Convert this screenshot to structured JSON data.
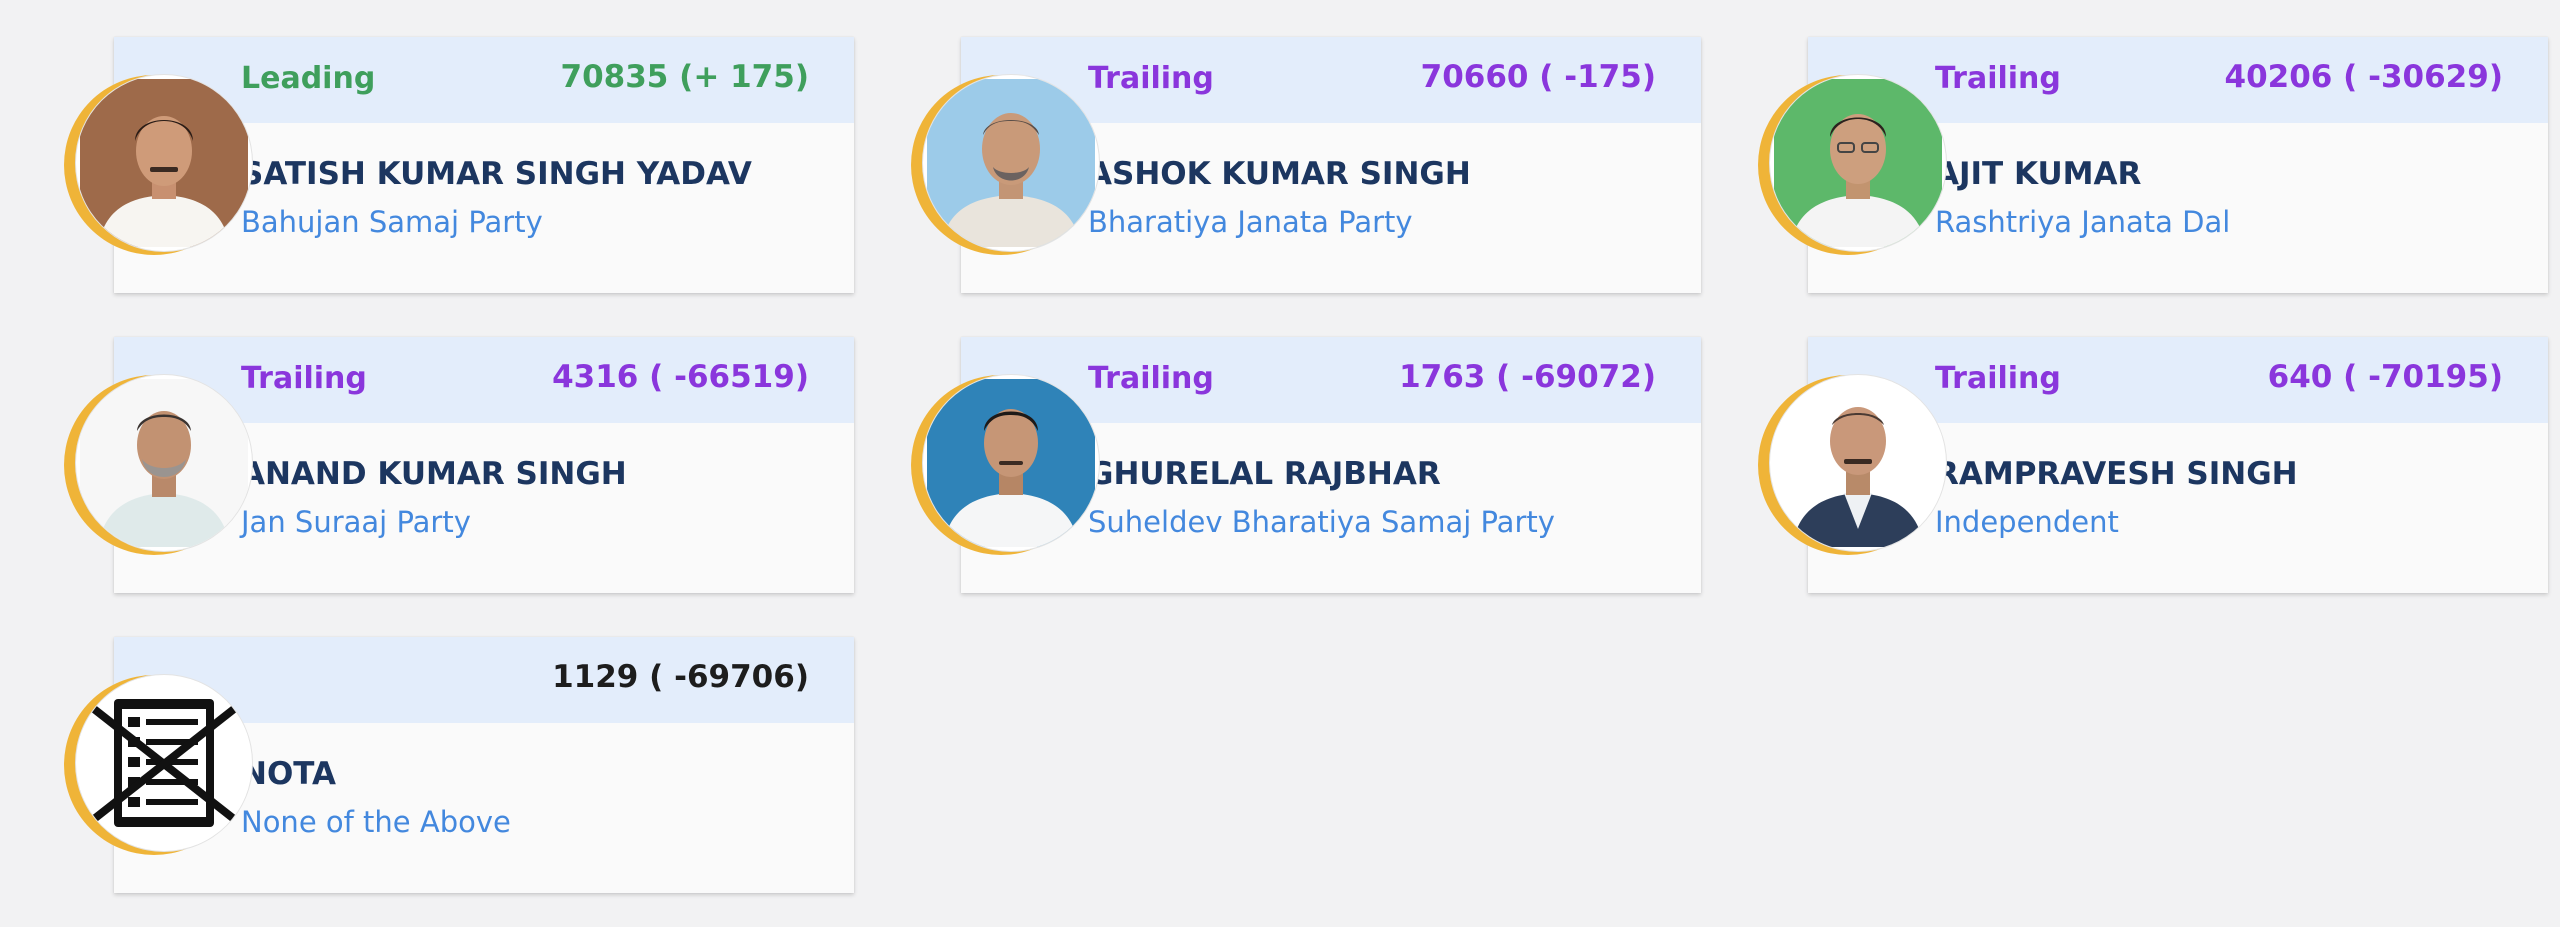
{
  "candidates": [
    {
      "status": "Leading",
      "votes": "70835 (+ 175)",
      "name": "SATISH KUMAR SINGH YADAV",
      "party": "Bahujan Samaj Party",
      "status_color": "#3f9f5c",
      "photo_icon": "candidate-photo-icon"
    },
    {
      "status": "Trailing",
      "votes": "70660 ( -175)",
      "name": "ASHOK KUMAR SINGH",
      "party": "Bharatiya Janata Party",
      "status_color": "#8a36dc",
      "photo_icon": "candidate-photo-icon"
    },
    {
      "status": "Trailing",
      "votes": "40206 ( -30629)",
      "name": "AJIT KUMAR",
      "party": "Rashtriya Janata Dal",
      "status_color": "#8a36dc",
      "photo_icon": "candidate-photo-icon"
    },
    {
      "status": "Trailing",
      "votes": "4316 ( -66519)",
      "name": "ANAND KUMAR SINGH",
      "party": "Jan Suraaj Party",
      "status_color": "#8a36dc",
      "photo_icon": "candidate-photo-icon"
    },
    {
      "status": "Trailing",
      "votes": "1763 ( -69072)",
      "name": "GHURELAL RAJBHAR",
      "party": "Suheldev Bharatiya Samaj Party",
      "status_color": "#8a36dc",
      "photo_icon": "candidate-photo-icon"
    },
    {
      "status": "Trailing",
      "votes": "640 ( -70195)",
      "name": "RAMPRAVESH SINGH",
      "party": "Independent",
      "status_color": "#8a36dc",
      "photo_icon": "candidate-photo-icon"
    },
    {
      "status": "",
      "votes": "1129 ( -69706)",
      "name": "NOTA",
      "party": "None of the Above",
      "status_color": "#1d1d1d",
      "photo_icon": "nota-crossed-list-icon"
    }
  ],
  "colors": {
    "page_background": "#f2f2f3",
    "card_background": "#fafafa",
    "card_header_background": "#e3edfb",
    "candidate_name": "#1c3660",
    "party_name": "#4388de",
    "avatar_ring": "#efb438"
  }
}
